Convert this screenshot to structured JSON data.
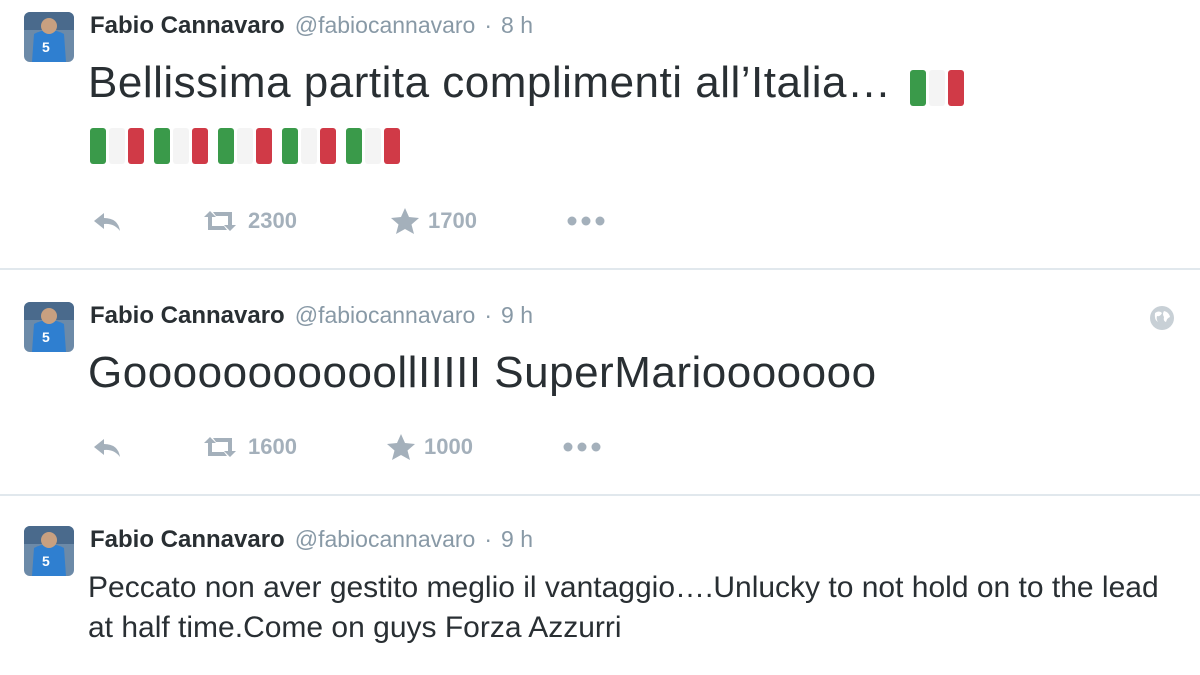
{
  "tweets": [
    {
      "author_name": "Fabio Cannavaro",
      "handle": "@fabiocannavaro",
      "separator": "·",
      "time": "8 h",
      "text": "Bellissima partita complimenti all’Italia…",
      "flag_count": 5,
      "retweets": "2300",
      "favorites": "1700"
    },
    {
      "author_name": "Fabio Cannavaro",
      "handle": "@fabiocannavaro",
      "separator": "·",
      "time": "9 h",
      "text": "GooooooooooollIIIII SuperMariooooooo",
      "retweets": "1600",
      "favorites": "1000"
    },
    {
      "author_name": "Fabio Cannavaro",
      "handle": "@fabiocannavaro",
      "separator": "·",
      "time": "9 h",
      "text": "Peccato non aver gestito meglio il vantaggio….Unlucky to not hold on to the lead at half time.Come on guys Forza Azzurri"
    }
  ],
  "icons": {
    "reply": "reply-icon",
    "retweet": "retweet-icon",
    "favorite": "star-icon",
    "more": "more-icon",
    "globe": "globe-icon",
    "flag": "italy-flag-icon"
  },
  "colors": {
    "flag_green": "#3a9a4a",
    "flag_white": "#f4f4f4",
    "flag_red": "#d03a47",
    "action_grey": "#a4b0bb",
    "meta_grey": "#8899a6",
    "divider": "#e1e8ed"
  }
}
